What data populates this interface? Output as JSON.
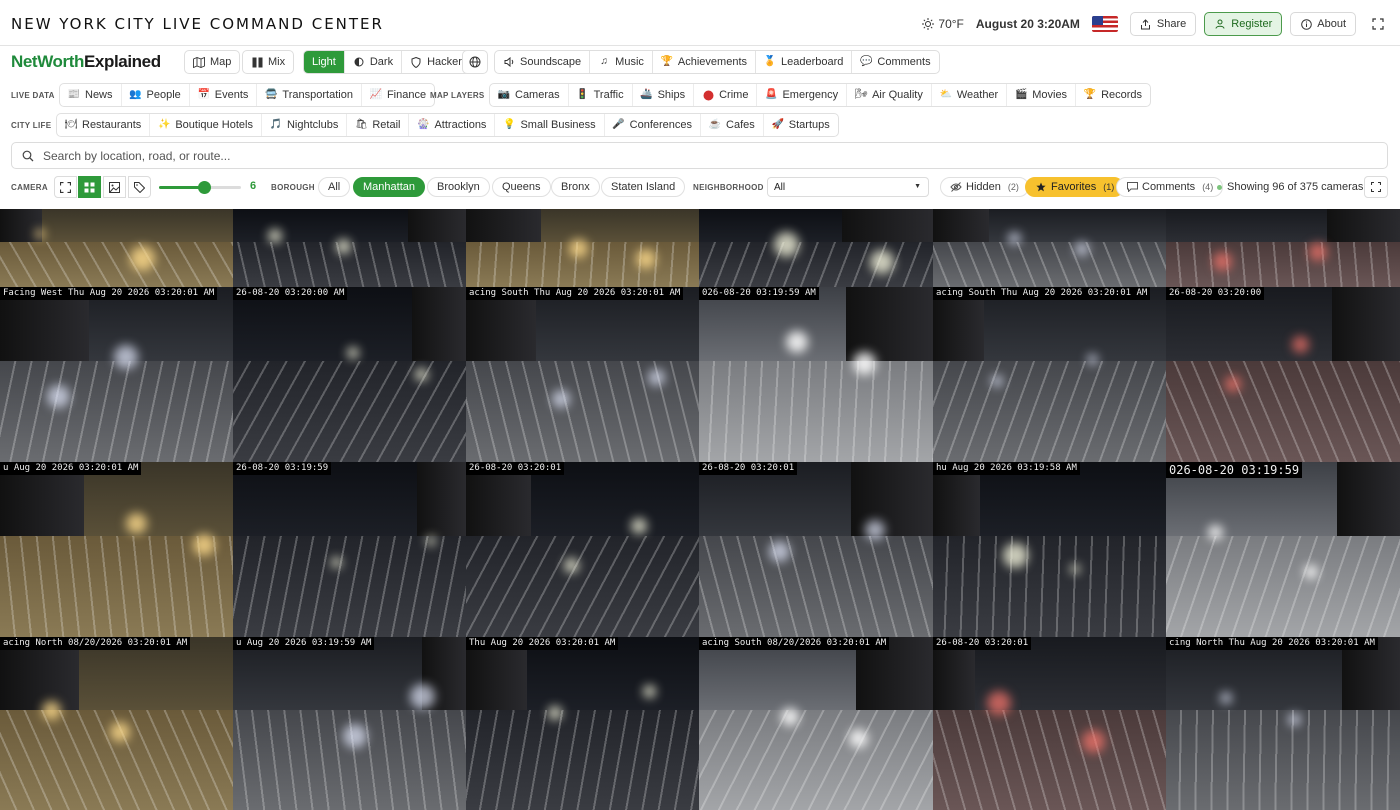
{
  "header": {
    "title": "NEW YORK CITY LIVE COMMAND CENTER",
    "temperature": "70°F",
    "datetime": "August 20 3:20AM",
    "share_label": "Share",
    "register_label": "Register",
    "about_label": "About"
  },
  "brand": {
    "part1": "NetWorth",
    "part2": "Explained"
  },
  "view_modes": [
    {
      "label": "Map",
      "icon": "map-icon"
    },
    {
      "label": "Mix",
      "icon": "columns-icon"
    }
  ],
  "themes": [
    {
      "label": "Light",
      "active": true
    },
    {
      "label": "Dark",
      "icon": "half-moon-icon"
    },
    {
      "label": "Hacker",
      "icon": "shield-icon"
    }
  ],
  "features": [
    {
      "label": "Soundscape",
      "icon": "speaker-icon"
    },
    {
      "label": "Music",
      "icon": "music-note-icon"
    },
    {
      "label": "Achievements",
      "icon": "trophy-icon"
    },
    {
      "label": "Leaderboard",
      "icon": "medal-icon"
    },
    {
      "label": "Comments",
      "icon": "speech-bubble-icon"
    }
  ],
  "live_data": {
    "label": "LIVE DATA",
    "items": [
      {
        "label": "News",
        "icon": "newspaper-icon"
      },
      {
        "label": "People",
        "icon": "people-icon"
      },
      {
        "label": "Events",
        "icon": "calendar-icon"
      },
      {
        "label": "Transportation",
        "icon": "bus-icon"
      },
      {
        "label": "Finance",
        "icon": "chart-icon"
      }
    ]
  },
  "map_layers": {
    "label": "MAP LAYERS",
    "items": [
      {
        "label": "Cameras",
        "icon": "camera-icon"
      },
      {
        "label": "Traffic",
        "icon": "traffic-light-icon"
      },
      {
        "label": "Ships",
        "icon": "ship-icon"
      },
      {
        "label": "Crime",
        "icon": "red-circle-icon"
      },
      {
        "label": "Emergency",
        "icon": "siren-icon"
      },
      {
        "label": "Air Quality",
        "icon": "wind-icon"
      },
      {
        "label": "Weather",
        "icon": "sun-cloud-icon"
      },
      {
        "label": "Movies",
        "icon": "clapper-icon"
      },
      {
        "label": "Records",
        "icon": "trophy-icon"
      }
    ]
  },
  "city_life": {
    "label": "CITY LIFE",
    "items": [
      {
        "label": "Restaurants",
        "icon": "fork-knife-icon"
      },
      {
        "label": "Boutique Hotels",
        "icon": "sparkle-icon"
      },
      {
        "label": "Nightclubs",
        "icon": "music-note-icon"
      },
      {
        "label": "Retail",
        "icon": "shopping-bag-icon"
      },
      {
        "label": "Attractions",
        "icon": "ferris-wheel-icon"
      },
      {
        "label": "Small Business",
        "icon": "light-bulb-icon"
      },
      {
        "label": "Conferences",
        "icon": "microphone-icon"
      },
      {
        "label": "Cafes",
        "icon": "coffee-icon"
      },
      {
        "label": "Startups",
        "icon": "rocket-icon"
      }
    ]
  },
  "search": {
    "placeholder": "Search by location, road, or route..."
  },
  "camera_controls": {
    "label": "CAMERA",
    "grid_size": "6",
    "grid_size_fraction": 0.55,
    "borough_label": "BOROUGH",
    "boroughs": [
      "All",
      "Manhattan",
      "Brooklyn",
      "Queens",
      "Bronx",
      "Staten Island"
    ],
    "active_borough": "Manhattan",
    "neighborhood_label": "NEIGHBORHOOD",
    "neighborhood_value": "All",
    "hidden_label": "Hidden",
    "hidden_count": "(2)",
    "favorites_label": "Favorites",
    "favorites_count": "(1)",
    "comments_label": "Comments",
    "comments_count": "(4)",
    "showing_text": "Showing 96 of 375 cameras"
  },
  "cameras": [
    {
      "timestamp": "",
      "style": "gold"
    },
    {
      "timestamp": "",
      "style": "dark"
    },
    {
      "timestamp": "",
      "style": "gold"
    },
    {
      "timestamp": "",
      "style": "dark"
    },
    {
      "timestamp": "",
      "style": "gray"
    },
    {
      "timestamp": "",
      "style": "red"
    },
    {
      "timestamp": "Facing West Thu Aug 20 2026 03:20:01 AM",
      "style": "gray"
    },
    {
      "timestamp": "26-08-20 03:20:00 AM",
      "style": "dark"
    },
    {
      "timestamp": "acing South Thu Aug 20 2026 03:20:01 AM",
      "style": "gray"
    },
    {
      "timestamp": "026-08-20 03:19:59 AM",
      "style": "bright"
    },
    {
      "timestamp": "acing South Thu Aug 20 2026 03:20:01 AM",
      "style": "gray"
    },
    {
      "timestamp": "26-08-20 03:20:00",
      "style": "red"
    },
    {
      "timestamp": "u Aug 20 2026 03:20:01 AM",
      "style": "gold"
    },
    {
      "timestamp": "26-08-20 03:19:59",
      "style": "dark"
    },
    {
      "timestamp": "26-08-20     03:20:01",
      "style": "dark"
    },
    {
      "timestamp": "26-08-20 03:20:01",
      "style": "gray"
    },
    {
      "timestamp": "hu Aug 20 2026 03:19:58 AM",
      "style": "dark"
    },
    {
      "timestamp": "026-08-20 03:19:59",
      "style": "bright",
      "big": true
    },
    {
      "timestamp": "acing North 08/20/2026 03:20:01 AM",
      "style": "gold"
    },
    {
      "timestamp": "u Aug 20 2026 03:19:59 AM",
      "style": "gray"
    },
    {
      "timestamp": "Thu Aug 20 2026 03:20:01 AM",
      "style": "dark"
    },
    {
      "timestamp": "acing South 08/20/2026 03:20:01 AM",
      "style": "bright"
    },
    {
      "timestamp": "26-08-20 03:20:01",
      "style": "red"
    },
    {
      "timestamp": "cing North Thu Aug 20 2026 03:20:01 AM",
      "style": "gray"
    }
  ]
}
